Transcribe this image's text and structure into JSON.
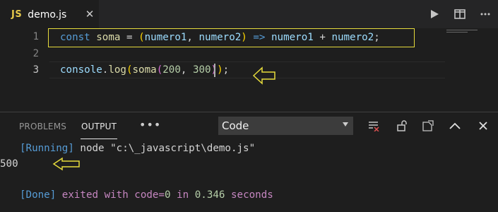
{
  "tab": {
    "icon_text": "JS",
    "filename": "demo.js",
    "close_glyph": "✕"
  },
  "editor_actions": [
    "run-icon",
    "split-editor-icon",
    "more-actions-icon"
  ],
  "editor": {
    "line_numbers": [
      "1",
      "2",
      "3"
    ],
    "line1": {
      "kw": "const",
      "name": "soma",
      "eq": " = ",
      "paren_open": "(",
      "p1": "numero1",
      "comma": ", ",
      "p2": "numero2",
      "paren_close": ")",
      "arrow": " => ",
      "b1": "numero1",
      "plus": " + ",
      "b2": "numero2",
      "semi": ";"
    },
    "line3": {
      "obj": "console",
      "dot": ".",
      "method": "log",
      "open1": "(",
      "fn": "soma",
      "open2": "(",
      "a1": "200",
      "sep": ", ",
      "a2": "300",
      "close2": ")",
      "close1": ")",
      "semi": ";"
    }
  },
  "panel": {
    "tabs": [
      "PROBLEMS",
      "OUTPUT"
    ],
    "more": "•••",
    "select_value": "Code",
    "actions": [
      "clear-output-icon",
      "lock-scroll-icon",
      "open-log-icon",
      "maximize-panel-icon",
      "close-panel-icon"
    ],
    "output": {
      "running_tag": "[Running]",
      "running_cmd": " node \"c:\\_javascript\\demo.js\"",
      "result": "500",
      "done_tag": "[Done]",
      "done_text": " exited with ",
      "code_label": "code=",
      "code_val": "0",
      "in_text": " in ",
      "time": "0.346",
      "seconds": " seconds"
    }
  },
  "colors": {
    "highlight": "#e6db3c",
    "keyword": "#569cd6",
    "function": "#dcdcaa",
    "variable": "#9cdcfe",
    "number": "#b5cea8"
  }
}
